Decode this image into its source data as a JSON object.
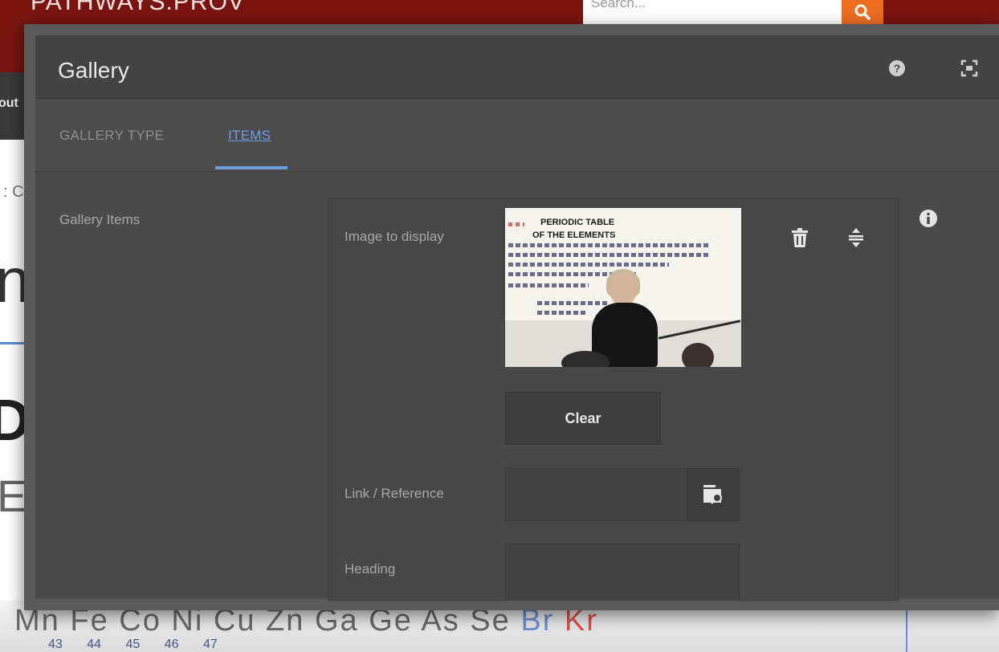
{
  "site": {
    "brand": "PATHWAYS.PROV",
    "search_placeholder": "Search...",
    "nav_partial": "out",
    "crumb_partial": ": C",
    "heading_partial_1": "n",
    "heading_partial_2": "D",
    "heading_partial_3": "E",
    "elements_row": [
      "Mn",
      "Fe",
      "Co",
      "Ni",
      "Cu",
      "Zn",
      "Ga",
      "Ge",
      "As",
      "Se",
      "Br",
      "Kr"
    ],
    "element_numbers": "43 44 45 46 47",
    "colors": {
      "header": "#7a1410",
      "search_button": "#ee6d1f"
    }
  },
  "dialog": {
    "title": "Gallery",
    "header_icons": [
      "help-icon",
      "fullscreen-icon"
    ],
    "tabs": [
      {
        "label": "GALLERY TYPE",
        "active": false
      },
      {
        "label": "ITEMS",
        "active": true
      }
    ],
    "accent": "#6f9ce0",
    "section_label": "Gallery Items",
    "fields": {
      "image_label": "Image to display",
      "image_caption_1": "PERIODIC TABLE",
      "image_caption_2": "OF THE ELEMENTS",
      "clear_label": "Clear",
      "link_label": "Link / Reference",
      "link_value": "",
      "heading_label": "Heading",
      "heading_value": ""
    },
    "item_actions": [
      "trash-icon",
      "reorder-icon"
    ],
    "info_icon": "info-icon"
  }
}
